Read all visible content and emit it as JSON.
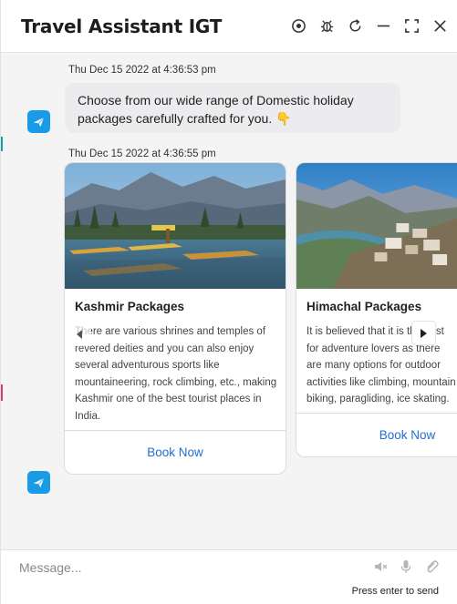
{
  "header": {
    "title": "Travel Assistant IGT",
    "icons": [
      "record-icon",
      "bug-icon",
      "refresh-icon",
      "minimize-icon",
      "expand-icon",
      "close-icon"
    ]
  },
  "messages": [
    {
      "timestamp": "Thu Dec 15 2022 at 4:36:53 pm",
      "text": "Choose from our wide range of Domestic holiday packages carefully crafted for you. 👇"
    },
    {
      "timestamp": "Thu Dec 15 2022 at 4:36:55 pm"
    }
  ],
  "cards": [
    {
      "title": "Kashmir Packages",
      "description": "There are various shrines and temples of revered deities and you can also enjoy several adventurous sports like mountaineering, rock climbing, etc., making Kashmir one of the best tourist places in India.",
      "button": "Book Now"
    },
    {
      "title": "Himachal Packages",
      "description": "It is believed that it is the best for adventure lovers as there are many options for outdoor activities like climbing, mountain biking, paragliding, ice skating.",
      "button": "Book Now"
    }
  ],
  "composer": {
    "placeholder": "Message...",
    "hint": "Press enter to send"
  },
  "colors": {
    "accent": "#1a9be6",
    "link": "#1f6fd1"
  }
}
